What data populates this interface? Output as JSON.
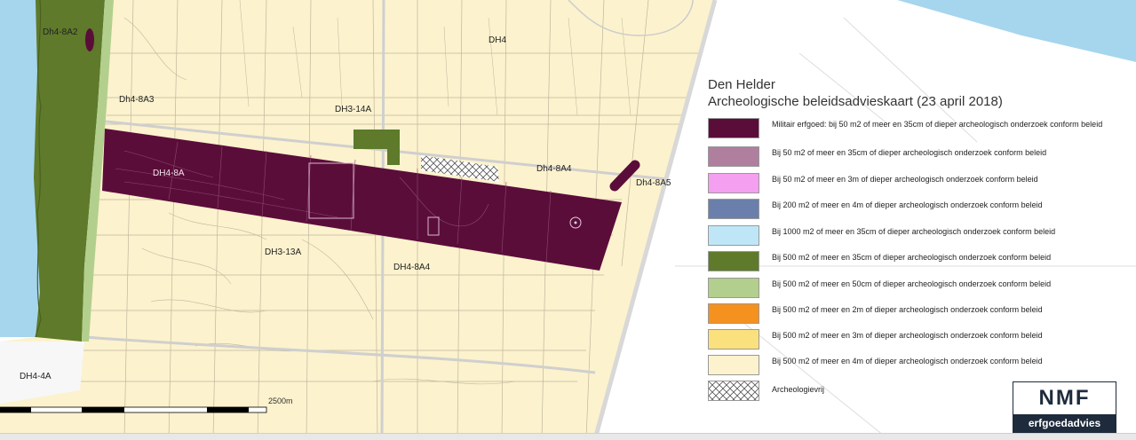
{
  "legend": {
    "title": "Den Helder",
    "subtitle": "Archeologische beleidsadvieskaart (23 april 2018)",
    "items": [
      {
        "color": "#5b0d3a",
        "label": "Militair erfgoed: bij 50 m2 of meer en 35cm of dieper archeologisch onderzoek conform beleid"
      },
      {
        "color": "#b07f9e",
        "label": "Bij 50 m2 of meer en 35cm of dieper archeologisch onderzoek conform beleid"
      },
      {
        "color": "#f59ff0",
        "label": "Bij 50 m2 of meer en 3m of dieper archeologisch onderzoek conform beleid"
      },
      {
        "color": "#6a7fab",
        "label": "Bij 200 m2 of meer en 4m of dieper archeologisch onderzoek conform beleid"
      },
      {
        "color": "#bfe6f7",
        "label": "Bij 1000 m2 of meer en 35cm of dieper archeologisch onderzoek conform beleid"
      },
      {
        "color": "#5e7a2a",
        "label": "Bij 500 m2 of meer en 35cm of dieper archeologisch onderzoek conform beleid"
      },
      {
        "color": "#b3cf8d",
        "label": "Bij 500 m2 of meer en 50cm of dieper archeologisch onderzoek conform beleid"
      },
      {
        "color": "#f5911e",
        "label": "Bij 500 m2 of meer en 2m of dieper archeologisch onderzoek conform beleid"
      },
      {
        "color": "#fbe17e",
        "label": "Bij 500 m2 of meer en 3m of dieper archeologisch onderzoek conform beleid"
      },
      {
        "color": "#fcf2cd",
        "label": "Bij 500 m2 of meer en 4m of dieper archeologisch onderzoek conform beleid"
      },
      {
        "color": "hatch",
        "label": "Archeologievrij"
      }
    ]
  },
  "zones": {
    "dh4_8a2": "Dh4-8A2",
    "dh4": "DH4",
    "dh4_8a3": "Dh4-8A3",
    "dh3_14a": "DH3-14A",
    "dh4_8a": "DH4-8A",
    "dh4_8a4_top": "Dh4-8A4",
    "dh4_8a5": "Dh4-8A5",
    "dh3_13a": "DH3-13A",
    "dh4_8a4_bottom": "DH4-8A4",
    "dh4_4a": "DH4-4A"
  },
  "scale": {
    "label": "2500m"
  },
  "logo": {
    "name": "NMF",
    "tagline": "erfgoedadvies"
  },
  "colors": {
    "sea": "#a6d5ee",
    "land": "#fcf2cd",
    "dune": "#5e7a2a",
    "military": "#5b0d3a"
  }
}
